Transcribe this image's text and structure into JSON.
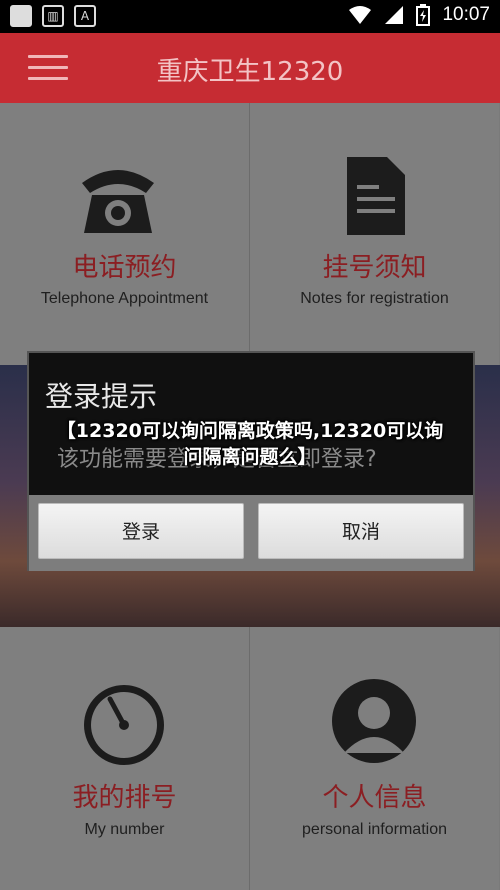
{
  "status_bar": {
    "time": "10:07"
  },
  "app_bar": {
    "title": "重庆卫生12320"
  },
  "grid": {
    "telephone": {
      "zh": "电话预约",
      "en": "Telephone Appointment"
    },
    "registration": {
      "zh": "挂号须知",
      "en": "Notes for registration"
    },
    "my_number": {
      "zh": "我的排号",
      "en": "My number"
    },
    "personal": {
      "zh": "个人信息",
      "en": "personal information"
    }
  },
  "dialog": {
    "title": "登录提示",
    "message": "该功能需要登录，是否立即登录?",
    "login_label": "登录",
    "cancel_label": "取消"
  },
  "overlay_caption": "【12320可以询问隔离政策吗,12320可以询问隔离问题么】",
  "colors": {
    "appbar": "#c62c33",
    "accent_text": "#8b1e22"
  }
}
